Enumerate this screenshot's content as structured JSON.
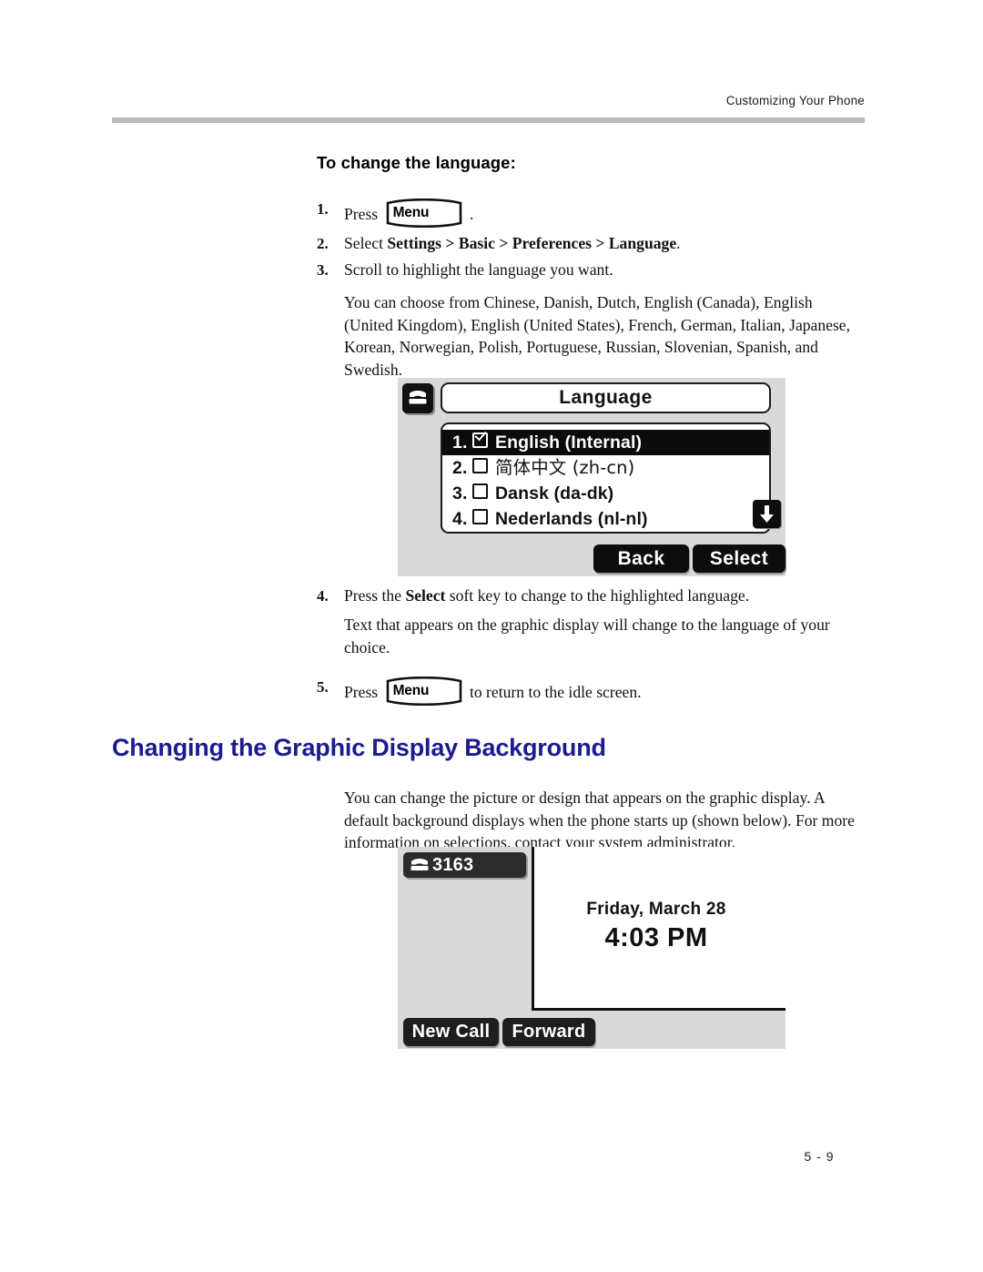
{
  "header": {
    "running_head": "Customizing Your Phone"
  },
  "procedure": {
    "heading": "To change the language:",
    "steps": [
      {
        "num": "1.",
        "pre": "Press",
        "key": "Menu",
        "post": "."
      },
      {
        "num": "2.",
        "text_plain": "Select ",
        "text_bold": "Settings > Basic > Preferences > Language",
        "text_end": "."
      },
      {
        "num": "3.",
        "text": "Scroll to highlight the language you want."
      },
      {
        "num": "4.",
        "pre": "Press the ",
        "bold": "Select",
        "post": " soft key to change to the highlighted language."
      },
      {
        "num": "5.",
        "pre": "Press",
        "key": "Menu",
        "post": "to return to the idle screen."
      }
    ],
    "languages_paragraph": "You can choose from Chinese, Danish, Dutch, English (Canada), English (United Kingdom), English (United States), French, German, Italian, Japanese, Korean, Norwegian, Polish, Portuguese, Russian, Slovenian, Spanish, and Swedish.",
    "result_paragraph": "Text that appears on the graphic display will change to the language of your choice."
  },
  "language_screen": {
    "status_icon": "handset-icon",
    "title": "Language",
    "items": [
      {
        "index": "1.",
        "label": "English (Internal)",
        "checked": true,
        "selected": true
      },
      {
        "index": "2.",
        "label": "简体中文 (zh-cn)",
        "checked": false,
        "selected": false
      },
      {
        "index": "3.",
        "label": "Dansk (da-dk)",
        "checked": false,
        "selected": false
      },
      {
        "index": "4.",
        "label": "Nederlands (nl-nl)",
        "checked": false,
        "selected": false
      }
    ],
    "scroll_indicator": "arrow-down-icon",
    "softkeys": [
      "Back",
      "Select"
    ]
  },
  "section": {
    "heading": "Changing the Graphic Display Background",
    "heading_color": "#1b1b8f",
    "paragraph": "You can change the picture or design that appears on the graphic display. A default background displays when the phone starts up (shown below). For more information on selections, contact your system administrator."
  },
  "idle_screen": {
    "line_key_icon": "handset-icon",
    "line_key_label": "3163",
    "date": "Friday, March 28",
    "time": "4:03 PM",
    "softkeys": [
      "New Call",
      "Forward"
    ]
  },
  "footer": {
    "page_number": "5 - 9"
  }
}
